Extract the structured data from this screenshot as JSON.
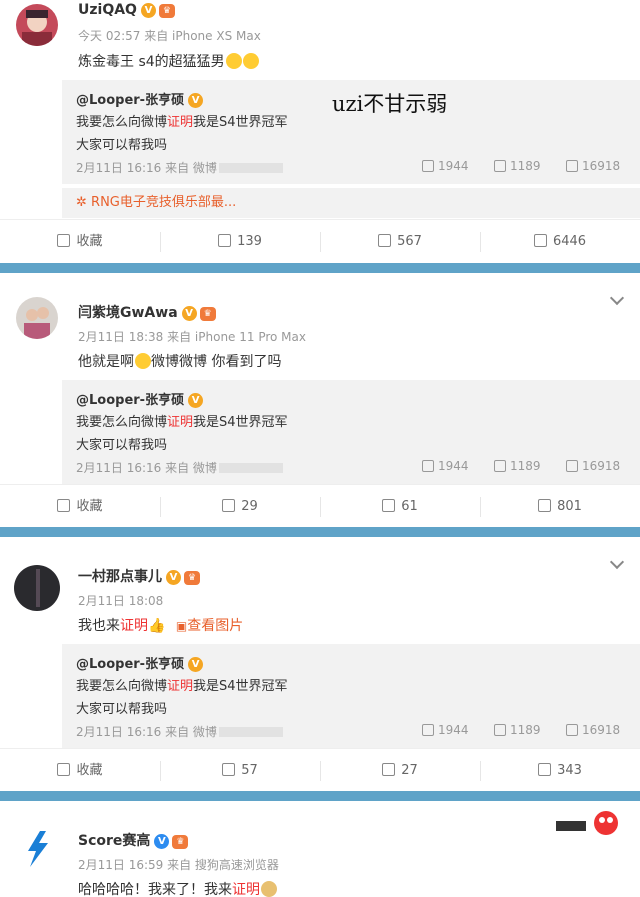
{
  "posts": [
    {
      "username": "UziQAQ",
      "meta": "今天 02:57 来自 iPhone XS Max",
      "text": "炼金毒王 s4的超猛猛男",
      "overlay_caption": "uzi不甘示弱",
      "repost": {
        "user": "@Looper-张亨硕",
        "line1_pre": "我要怎么向微博",
        "line1_red": "证明",
        "line1_post": "我是S4世界冠军",
        "line2": "大家可以帮我吗",
        "meta": "2月11日 16:16 来自 微博",
        "shares": "1944",
        "comments": "1189",
        "likes": "16918"
      },
      "link": "RNG电子竞技俱乐部最...",
      "actions": {
        "favorite": "收藏",
        "share": "139",
        "comment": "567",
        "like": "6446"
      }
    },
    {
      "username": "闫紫境GwAwa",
      "meta": "2月11日 18:38 来自 iPhone 11 Pro Max",
      "text_pre": "他就是啊",
      "text_post": "微博微博 你看到了吗",
      "repost": {
        "user": "@Looper-张亨硕",
        "line1_pre": "我要怎么向微博",
        "line1_red": "证明",
        "line1_post": "我是S4世界冠军",
        "line2": "大家可以帮我吗",
        "meta": "2月11日 16:16 来自 微博",
        "shares": "1944",
        "comments": "1189",
        "likes": "16918"
      },
      "actions": {
        "favorite": "收藏",
        "share": "29",
        "comment": "61",
        "like": "801"
      }
    },
    {
      "username": "一村那点事儿",
      "meta": "2月11日 18:08",
      "text_pre": "我也来",
      "text_red": "证明",
      "view_image": "查看图片",
      "repost": {
        "user": "@Looper-张亨硕",
        "line1_pre": "我要怎么向微博",
        "line1_red": "证明",
        "line1_post": "我是S4世界冠军",
        "line2": "大家可以帮我吗",
        "meta": "2月11日 16:16 来自 微博",
        "shares": "1944",
        "comments": "1189",
        "likes": "16918"
      },
      "actions": {
        "favorite": "收藏",
        "share": "57",
        "comment": "27",
        "like": "343"
      }
    },
    {
      "username": "Score赛高",
      "meta": "2月11日 16:59 来自 搜狗高速浏览器",
      "text_pre": "哈哈哈哈！我来了！我来",
      "text_red": "证明"
    }
  ],
  "colors": {
    "separator": "#5fa3c8",
    "highlight": "#e33333",
    "link": "#e8602c",
    "verified": "#f5a623"
  }
}
